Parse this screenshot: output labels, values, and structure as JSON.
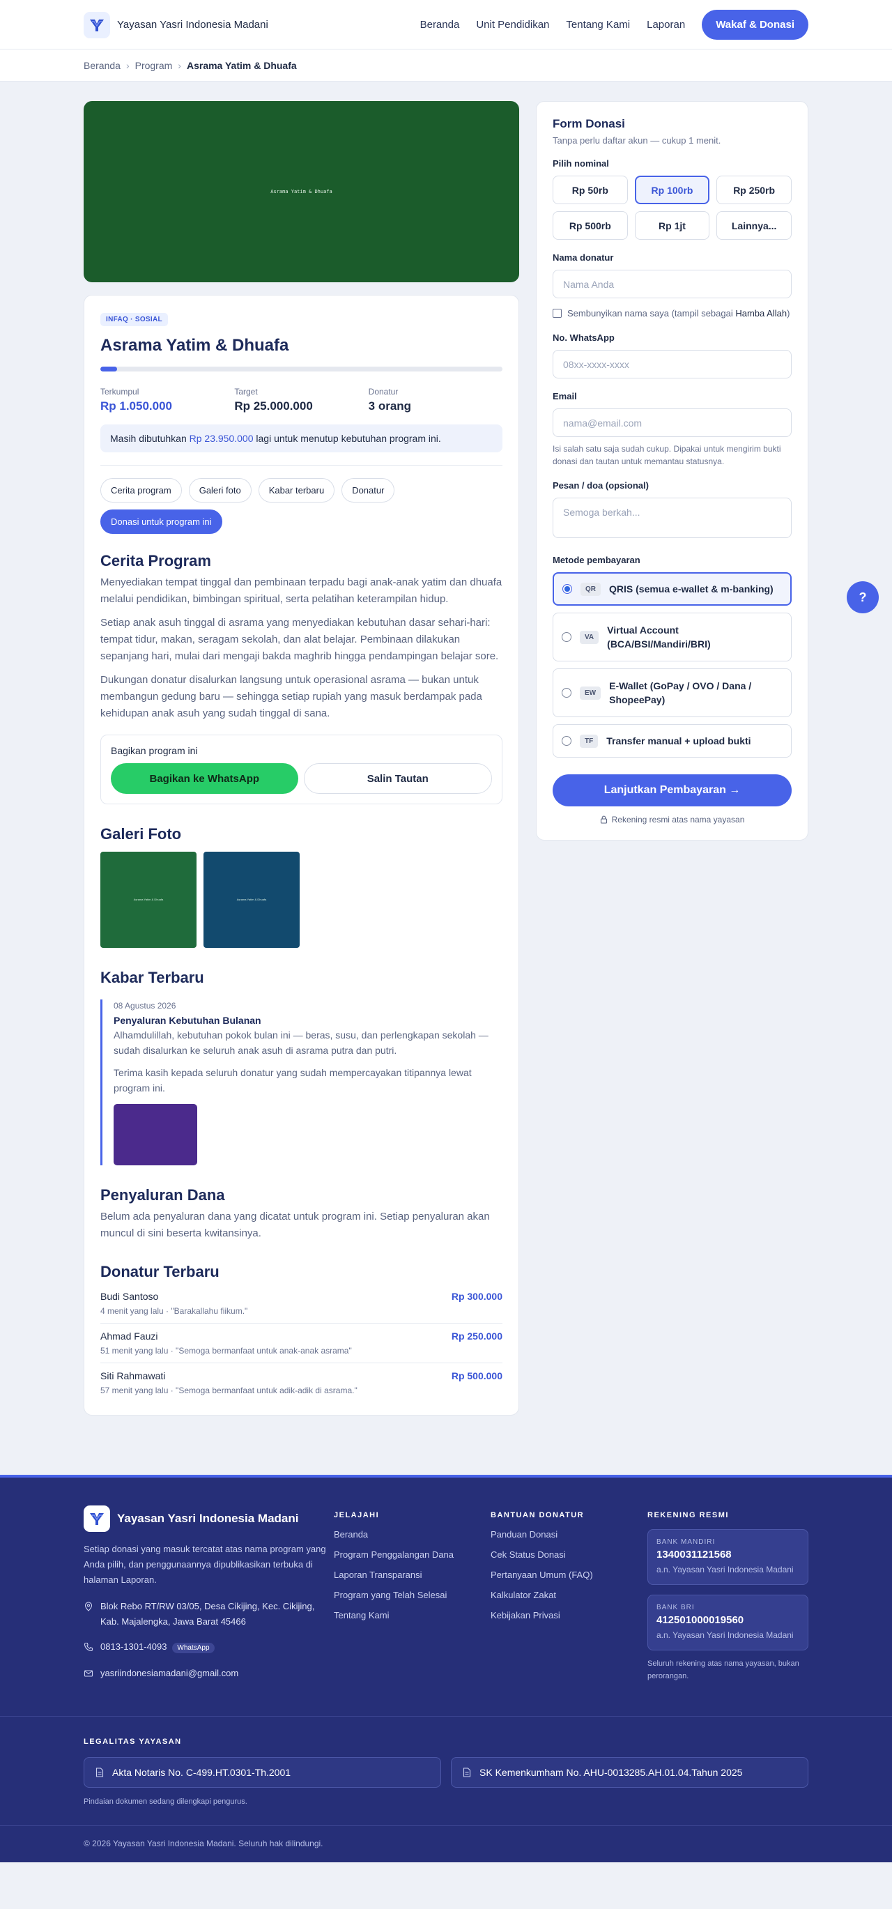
{
  "header": {
    "brand": "Yayasan Yasri Indonesia Madani",
    "nav": [
      "Beranda",
      "Unit Pendidikan",
      "Tentang Kami",
      "Laporan"
    ],
    "cta": "Wakaf & Donasi"
  },
  "breadcrumb": [
    "Beranda",
    "Program",
    "Asrama Yatim & Dhuafa"
  ],
  "hero": {
    "caption": "Asrama Yatim & Dhuafa",
    "color": "#1b5c2b"
  },
  "program": {
    "badge": "INFAQ · SOSIAL",
    "title": "Asrama Yatim & Dhuafa",
    "progress_percent": 4.2,
    "stats": [
      {
        "label": "Terkumpul",
        "value": "Rp 1.050.000"
      },
      {
        "label": "Target",
        "value": "Rp 25.000.000"
      },
      {
        "label": "Donatur",
        "value": "3 orang"
      }
    ],
    "needed_prefix": "Masih dibutuhkan ",
    "needed_amount": "Rp 23.950.000",
    "needed_suffix": " lagi untuk menutup kebutuhan program ini.",
    "tabs": [
      "Cerita program",
      "Galeri foto",
      "Kabar terbaru",
      "Donatur",
      "Donasi untuk program ini"
    ]
  },
  "story": {
    "title": "Cerita Program",
    "paragraphs": [
      "Menyediakan tempat tinggal dan pembinaan terpadu bagi anak-anak yatim dan dhuafa melalui pendidikan, bimbingan spiritual, serta pelatihan keterampilan hidup.",
      "Setiap anak asuh tinggal di asrama yang menyediakan kebutuhan dasar sehari-hari: tempat tidur, makan, seragam sekolah, dan alat belajar. Pembinaan dilakukan sepanjang hari, mulai dari mengaji bakda maghrib hingga pendampingan belajar sore.",
      "Dukungan donatur disalurkan langsung untuk operasional asrama — bukan untuk membangun gedung baru — sehingga setiap rupiah yang masuk berdampak pada kehidupan anak asuh yang sudah tinggal di sana."
    ]
  },
  "share": {
    "title": "Bagikan program ini",
    "whatsapp": "Bagikan ke WhatsApp",
    "copy": "Salin Tautan"
  },
  "gallery": {
    "title": "Galeri Foto",
    "images": [
      {
        "caption": "Asrama Yatim & Dhuafa",
        "color": "#1f6b3b"
      },
      {
        "caption": "Asrama Yatim & Dhuafa",
        "color": "#124a6e"
      }
    ]
  },
  "news": {
    "title": "Kabar Terbaru",
    "date": "08 Agustus 2026",
    "headline": "Penyaluran Kebutuhan Bulanan",
    "body1": "Alhamdulillah, kebutuhan pokok bulan ini — beras, susu, dan perlengkapan sekolah — sudah disalurkan ke seluruh anak asuh di asrama putra dan putri.",
    "body2": "Terima kasih kepada seluruh donatur yang sudah mempercayakan titipannya lewat program ini."
  },
  "distribution": {
    "title": "Penyaluran Dana",
    "text": "Belum ada penyaluran dana yang dicatat untuk program ini. Setiap penyaluran akan muncul di sini beserta kwitansinya."
  },
  "donors": {
    "title": "Donatur Terbaru",
    "items": [
      {
        "name": "Budi Santoso",
        "meta": "4 menit yang lalu · \"Barakallahu fiikum.\"",
        "amount": "Rp 300.000"
      },
      {
        "name": "Ahmad Fauzi",
        "meta": "51 menit yang lalu · \"Semoga bermanfaat untuk anak-anak asrama\"",
        "amount": "Rp 250.000"
      },
      {
        "name": "Siti Rahmawati",
        "meta": "57 menit yang lalu · \"Semoga bermanfaat untuk adik-adik di asrama.\"",
        "amount": "Rp 500.000"
      }
    ]
  },
  "form": {
    "title": "Form Donasi",
    "subtitle": "Tanpa perlu daftar akun — cukup 1 menit.",
    "amount_label": "Pilih nominal",
    "amounts": [
      "Rp 50rb",
      "Rp 100rb",
      "Rp 250rb",
      "Rp 500rb",
      "Rp 1jt",
      "Lainnya..."
    ],
    "selected_amount": "Rp 100rb",
    "name_label": "Nama donatur",
    "name_placeholder": "Nama Anda",
    "anon_prefix": "Sembunyikan nama saya (tampil sebagai ",
    "anon_strong": "Hamba Allah",
    "anon_suffix": ")",
    "wa_label": "No. WhatsApp",
    "wa_placeholder": "08xx-xxxx-xxxx",
    "email_label": "Email",
    "email_placeholder": "nama@email.com",
    "contact_hint": "Isi salah satu saja sudah cukup. Dipakai untuk mengirim bukti donasi dan tautan untuk memantau statusnya.",
    "message_label": "Pesan / doa (opsional)",
    "message_placeholder": "Semoga berkah...",
    "method_label": "Metode pembayaran",
    "methods": [
      {
        "tag": "QR",
        "label": "QRIS (semua e-wallet & m-banking)"
      },
      {
        "tag": "VA",
        "label": "Virtual Account (BCA/BSI/Mandiri/BRI)"
      },
      {
        "tag": "EW",
        "label": "E-Wallet (GoPay / OVO / Dana / ShopeePay)"
      },
      {
        "tag": "TF",
        "label": "Transfer manual + upload bukti"
      }
    ],
    "selected_method": "QR",
    "submit": "Lanjutkan Pembayaran →",
    "secure_note": "Rekening resmi atas nama yayasan"
  },
  "help_button": "?",
  "footer": {
    "brand": "Yayasan Yasri Indonesia Madani",
    "description": "Setiap donasi yang masuk tercatat atas nama program yang Anda pilih, dan penggunaannya dipublikasikan terbuka di halaman Laporan.",
    "address": "Blok Rebo RT/RW 03/05, Desa Cikijing, Kec. Cikijing, Kab. Majalengka, Jawa Barat 45466",
    "phone": "0813-1301-4093",
    "phone_badge": "WhatsApp",
    "email": "yasriindonesiamadani@gmail.com",
    "explore_title": "JELAJAHI",
    "explore": [
      "Beranda",
      "Program Penggalangan Dana",
      "Laporan Transparansi",
      "Program yang Telah Selesai",
      "Tentang Kami"
    ],
    "help_title": "BANTUAN DONATUR",
    "help": [
      "Panduan Donasi",
      "Cek Status Donasi",
      "Pertanyaan Umum (FAQ)",
      "Kalkulator Zakat",
      "Kebijakan Privasi"
    ],
    "accounts_title": "REKENING RESMI",
    "accounts": [
      {
        "bank": "BANK MANDIRI",
        "number": "1340031121568",
        "holder": "a.n. Yayasan Yasri Indonesia Madani"
      },
      {
        "bank": "BANK BRI",
        "number": "412501000019560",
        "holder": "a.n. Yayasan Yasri Indonesia Madani"
      }
    ],
    "accounts_note": "Seluruh rekening atas nama yayasan, bukan perorangan.",
    "legal_title": "LEGALITAS YAYASAN",
    "legal": [
      "Akta Notaris No. C-499.HT.0301-Th.2001",
      "SK Kemenkumham No. AHU-0013285.AH.01.04.Tahun 2025"
    ],
    "legal_note": "Pindaian dokumen sedang dilengkapi pengurus.",
    "copyright": "© 2026 Yayasan Yasri Indonesia Madani. Seluruh hak dilindungi."
  },
  "colors": {
    "accent": "#4863e8",
    "footer_bg": "#262f78",
    "whatsapp": "#27cc67"
  }
}
